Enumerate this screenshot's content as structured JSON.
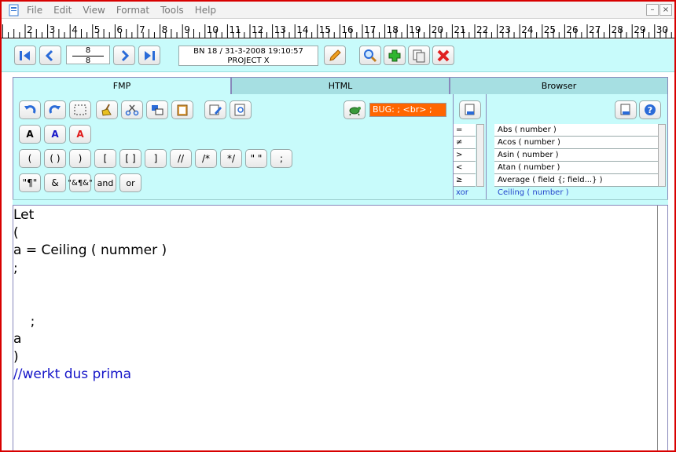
{
  "menu": [
    "File",
    "Edit",
    "View",
    "Format",
    "Tools",
    "Help"
  ],
  "window": {
    "minimize_symbol": "–",
    "close_symbol": "×"
  },
  "ruler": {
    "labels": [
      "2",
      "3",
      "4",
      "5",
      "6",
      "7",
      "8",
      "9",
      "10",
      "11",
      "12",
      "13",
      "14",
      "15",
      "16",
      "17",
      "18",
      "19",
      "20",
      "21",
      "22",
      "23",
      "24",
      "25",
      "26",
      "27",
      "28",
      "29",
      "30",
      "31"
    ]
  },
  "toolbar": {
    "record_current": "8",
    "record_total": "8",
    "info_line1": "BN 18 /  31-3-2008 19:10:57",
    "info_line2": "PROJECT X"
  },
  "tabs": [
    "FMP",
    "HTML",
    "Browser"
  ],
  "buttons": {
    "font_a1": "A",
    "font_a2": "A",
    "font_a3": "A",
    "row2": [
      "(",
      "( )",
      ")",
      "[",
      "[ ]",
      "]",
      "//",
      "/*",
      "*/",
      "\" \"",
      ";"
    ],
    "row3": [
      "\"¶\"",
      "&",
      "\"&¶&\"",
      "and",
      "or"
    ]
  },
  "bug_text": "BUG: ; <br> ;",
  "operators": [
    "=",
    "≠",
    ">",
    "<",
    "≥",
    "xor"
  ],
  "functions": [
    "Abs ( number )",
    "Acos ( number )",
    "Asin ( number )",
    "Atan ( number )",
    "Average ( field {; field...} )",
    "Ceiling ( number )"
  ],
  "editor_lines": [
    "Let",
    "(",
    "a = Ceiling ( nummer )",
    ";",
    "",
    "",
    "    ;",
    "a",
    ")",
    "//werkt dus prima"
  ],
  "colors": {
    "panel": "#c8fbfb",
    "accent_blue": "#2a6bd8",
    "bug": "#ff6600",
    "comment": "#1515c8"
  }
}
